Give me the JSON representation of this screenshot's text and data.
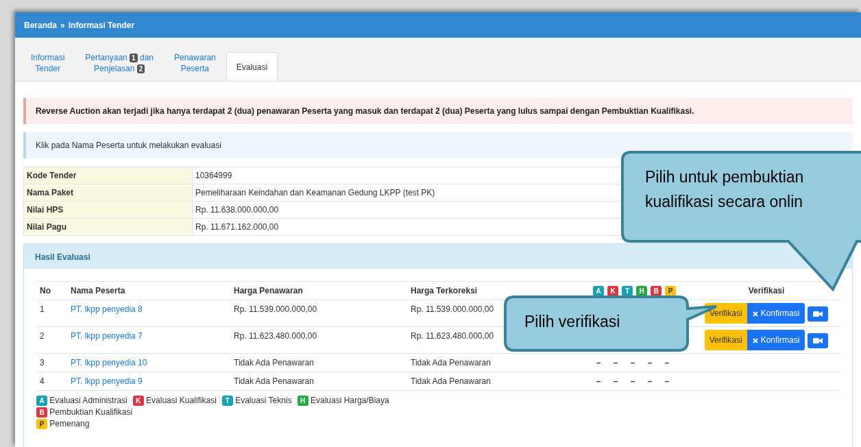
{
  "breadcrumb": {
    "home": "Beranda",
    "separator": "»",
    "current": "Informasi Tender"
  },
  "tabs": [
    {
      "lines": [
        "Informasi",
        "Tender"
      ],
      "selected": false
    },
    {
      "lines": [
        "Pertanyaan",
        "Penjelasan"
      ],
      "badges": [
        "1",
        "2"
      ],
      "joiner": "dan",
      "selected": false
    },
    {
      "lines": [
        "Penawaran",
        "Peserta"
      ],
      "selected": false
    },
    {
      "lines": [
        "Evaluasi"
      ],
      "selected": true
    }
  ],
  "alerts": [
    {
      "kind": "danger",
      "text": "Reverse Auction akan terjadi jika hanya terdapat 2 (dua) penawaran Peserta yang masuk dan terdapat 2 (dua) Peserta yang lulus sampai dengan Pembuktian Kualifikasi."
    },
    {
      "kind": "info",
      "text": "Klik pada Nama Peserta untuk melakukan evaluasi"
    }
  ],
  "info_table": [
    {
      "label": "Kode Tender",
      "value": "10364999"
    },
    {
      "label": "Nama Paket",
      "value": "Pemeliharaan Keindahan dan Keamanan Gedung LKPP (test PK)"
    },
    {
      "label": "Nilai HPS",
      "value": "Rp. 11.638.000.000,00"
    },
    {
      "label": "Nilai Pagu",
      "value": "Rp. 11.671.162.000,00"
    }
  ],
  "panel": {
    "title": "Hasil Evaluasi",
    "columns": [
      "No",
      "Nama Peserta",
      "Harga Penawaran",
      "Harga Terkoreksi",
      "Verifikasi"
    ],
    "stages": [
      {
        "letter": "A",
        "color": "#17a2b8"
      },
      {
        "letter": "K",
        "color": "#dc3545"
      },
      {
        "letter": "T",
        "color": "#17a2b8"
      },
      {
        "letter": "H",
        "color": "#28a745"
      },
      {
        "letter": "B",
        "color": "#dc3545"
      },
      {
        "letter": "P",
        "color": "#ffc107"
      }
    ],
    "legend": [
      {
        "letter": "A",
        "color": "#17a2b8",
        "label": "Evaluasi Administrasi"
      },
      {
        "letter": "K",
        "color": "#dc3545",
        "label": "Evaluasi Kualifikasi"
      },
      {
        "letter": "T",
        "color": "#17a2b8",
        "label": "Evaluasi Teknis"
      },
      {
        "letter": "H",
        "color": "#28a745",
        "label": "Evaluasi Harga/Biaya"
      },
      {
        "letter": "B",
        "color": "#dc3545",
        "label": "Pembuktian Kualifikasi"
      },
      {
        "letter": "P",
        "color": "#ffc107",
        "label": "Pemenang"
      }
    ],
    "rows": [
      {
        "no": "1",
        "name": "PT. lkpp penyedia 8",
        "offer": "Rp. 11.539.000.000,00",
        "corrected": "Rp. 11.539.000.000,00",
        "marks": [],
        "actions": {
          "verify": "Verifikasi",
          "confirm": "Konfirmasi"
        }
      },
      {
        "no": "2",
        "name": "PT. lkpp penyedia 7",
        "offer": "Rp. 11.623.480.000,00",
        "corrected": "Rp. 11.623.480.000,00",
        "marks": [],
        "actions": {
          "verify": "Verifikasi",
          "confirm": "Konfirmasi"
        }
      },
      {
        "no": "3",
        "name": "PT. lkpp penyedia 10",
        "offer": "Tidak Ada Penawaran",
        "corrected": "Tidak Ada Penawaran",
        "marks": [
          "–",
          "–",
          "–",
          "–",
          "–"
        ]
      },
      {
        "no": "4",
        "name": "PT. lkpp penyedia 9",
        "offer": "Tidak Ada Penawaran",
        "corrected": "Tidak Ada Penawaran",
        "marks": [
          "–",
          "–",
          "–",
          "–",
          "–"
        ]
      }
    ]
  },
  "callouts": [
    {
      "kind": "down",
      "lines": [
        "Pilih untuk pembuktian",
        "kualifikasi secara onlin"
      ]
    },
    {
      "kind": "right",
      "lines": [
        "Pilih verifikasi"
      ]
    }
  ]
}
